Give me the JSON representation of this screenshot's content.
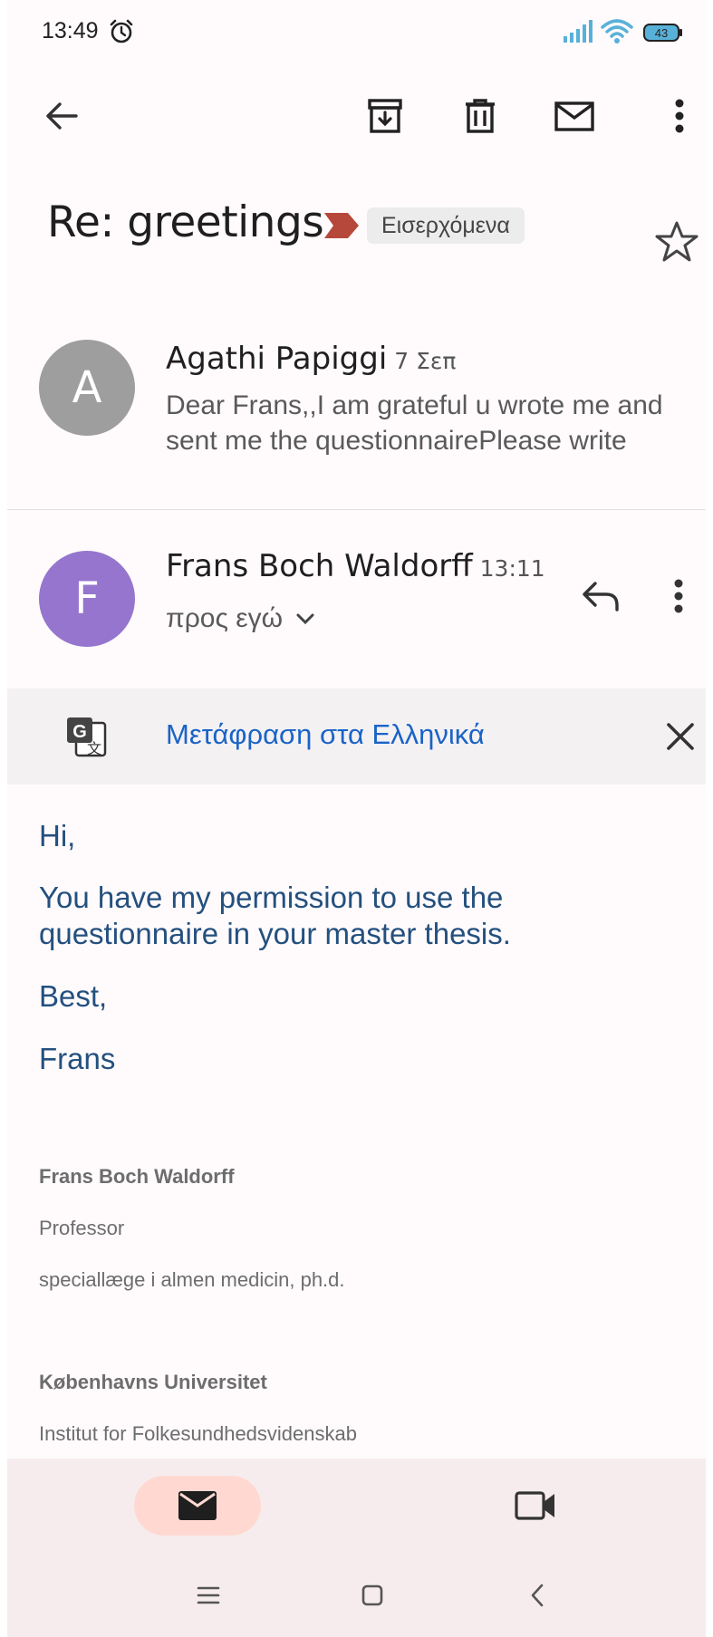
{
  "status_bar": {
    "time": "13:49",
    "battery": "43"
  },
  "toolbar": {
    "back": "back",
    "archive": "archive",
    "delete": "delete",
    "mark_unread": "mark unread",
    "more": "more options"
  },
  "subject": {
    "text": "Re: greetings",
    "label_chip": "Εισερχόμενα"
  },
  "messages": [
    {
      "avatar_letter": "A",
      "avatar_color": "#9e9e9e",
      "sender": "Agathi Papiggi",
      "date": "7 Σεπ",
      "snippet": "Dear Frans,,I am grateful u wrote me and sent me the questionnairePlease write"
    },
    {
      "avatar_letter": "F",
      "avatar_color": "#9575cd",
      "sender": "Frans Boch Waldorff",
      "date": "13:11",
      "recipient": "προς εγώ"
    }
  ],
  "translate": {
    "label": "Μετάφραση στα Ελληνικά"
  },
  "body": {
    "greeting": "Hi,",
    "paragraph": "You have my permission to use the questionnaire in your master thesis.",
    "closing": "Best,",
    "name": "Frans"
  },
  "signature": {
    "name": "Frans Boch Waldorff",
    "title": "Professor",
    "specialty": "speciallæge i almen medicin, ph.d.",
    "university": "Københavns Universitet",
    "institute": "Institut for Folkesundhedsvidenskab"
  },
  "colors": {
    "accent_blue": "#1a63c7",
    "body_text": "#24507e",
    "label_red": "#b5483a",
    "mail_pill": "#ffd9d1"
  }
}
